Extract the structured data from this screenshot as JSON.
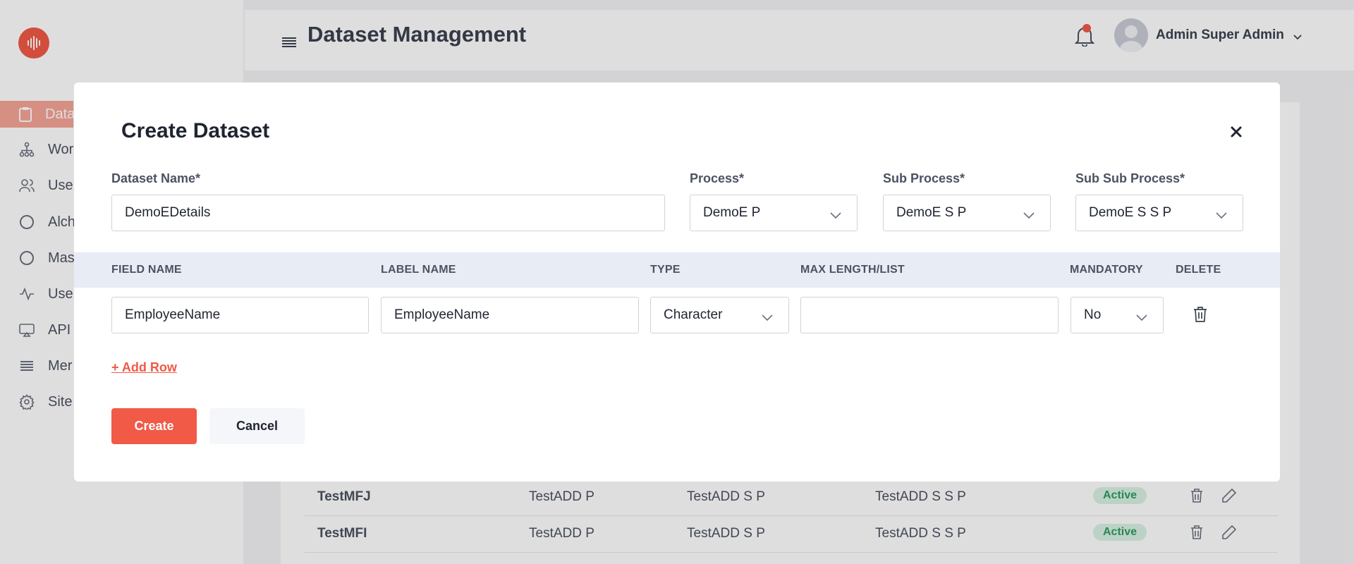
{
  "app": {
    "page_title": "Dataset Management",
    "user_name": "Admin Super Admin",
    "brand_color": "#f05a47"
  },
  "sidebar": {
    "items": [
      {
        "label": "Data",
        "icon": "clipboard-icon"
      },
      {
        "label": "Wor",
        "icon": "workflow-icon"
      },
      {
        "label": "Use",
        "icon": "users-icon"
      },
      {
        "label": "Alch",
        "icon": "circle-icon"
      },
      {
        "label": "Mas",
        "icon": "circle-icon"
      },
      {
        "label": "Use",
        "icon": "activity-icon"
      },
      {
        "label": "API",
        "icon": "airplay-icon"
      },
      {
        "label": "Mer",
        "icon": "menu-icon"
      },
      {
        "label": "Site",
        "icon": "gear-icon"
      }
    ]
  },
  "background_table": {
    "rows": [
      {
        "name": "TestMFJ",
        "process": "TestADD P",
        "sub_process": "TestADD S P",
        "sub_sub_process": "TestADD S S P",
        "status": "Active"
      },
      {
        "name": "TestMFI",
        "process": "TestADD P",
        "sub_process": "TestADD S P",
        "sub_sub_process": "TestADD S S P",
        "status": "Active"
      }
    ]
  },
  "modal": {
    "title": "Create Dataset",
    "dataset_name_label": "Dataset Name*",
    "dataset_name_value": "DemoEDetails",
    "process_label": "Process*",
    "process_value": "DemoE P",
    "sub_process_label": "Sub Process*",
    "sub_process_value": "DemoE S P",
    "sub_sub_process_label": "Sub Sub Process*",
    "sub_sub_process_value": "DemoE S S P",
    "columns": {
      "field_name": "FIELD NAME",
      "label_name": "LABEL NAME",
      "type": "TYPE",
      "max_length": "MAX LENGTH/LIST",
      "mandatory": "MANDATORY",
      "delete": "DELETE"
    },
    "row": {
      "field_name": "EmployeeName",
      "label_name": "EmployeeName",
      "type": "Character",
      "max_length": "",
      "mandatory": "No"
    },
    "add_row_label": "+ Add Row",
    "create_label": "Create",
    "cancel_label": "Cancel"
  }
}
